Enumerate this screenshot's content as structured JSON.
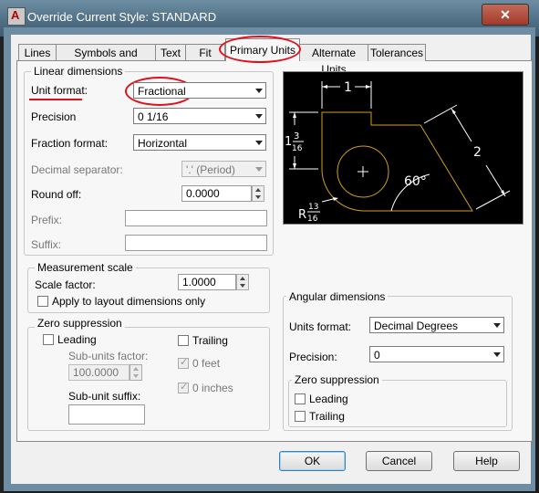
{
  "window": {
    "title": "Override Current Style: STANDARD",
    "close_glyph": "✕",
    "app_icon_letter": "A"
  },
  "tabs": [
    {
      "label": "Lines",
      "active": false
    },
    {
      "label": "Symbols and Arrows",
      "active": false
    },
    {
      "label": "Text",
      "active": false
    },
    {
      "label": "Fit",
      "active": false
    },
    {
      "label": "Primary Units",
      "active": true
    },
    {
      "label": "Alternate Units",
      "active": false
    },
    {
      "label": "Tolerances",
      "active": false
    }
  ],
  "linear": {
    "legend": "Linear dimensions",
    "unit_format": {
      "label": "Unit format:",
      "value": "Fractional"
    },
    "precision": {
      "label": "Precision",
      "value": "0 1/16"
    },
    "fraction_format": {
      "label": "Fraction format:",
      "value": "Horizontal"
    },
    "decimal_separator": {
      "label": "Decimal separator:",
      "value": "'.' (Period)"
    },
    "round_off": {
      "label": "Round off:",
      "value": "0.0000"
    },
    "prefix": {
      "label": "Prefix:",
      "value": ""
    },
    "suffix": {
      "label": "Suffix:",
      "value": ""
    }
  },
  "measurement": {
    "legend": "Measurement scale",
    "scale_factor": {
      "label": "Scale factor:",
      "value": "1.0000"
    },
    "apply_layout": {
      "label": "Apply to layout dimensions only",
      "checked": false
    }
  },
  "zero_suppression": {
    "legend": "Zero suppression",
    "leading": {
      "label": "Leading",
      "checked": false
    },
    "trailing": {
      "label": "Trailing",
      "checked": false
    },
    "sub_units_factor": {
      "label": "Sub-units factor:",
      "value": "100.0000"
    },
    "sub_unit_suffix": {
      "label": "Sub-unit suffix:",
      "value": ""
    },
    "zero_feet": {
      "label": "0 feet",
      "checked": true
    },
    "zero_inches": {
      "label": "0 inches",
      "checked": true
    }
  },
  "preview": {
    "dim_top": "1",
    "dim_left_whole": "1",
    "dim_left_num": "3",
    "dim_left_den": "16",
    "dim_right": "2",
    "dim_angle": "60°",
    "dim_radius_prefix": "R",
    "dim_radius_num": "13",
    "dim_radius_den": "16"
  },
  "angular": {
    "legend": "Angular dimensions",
    "units_format": {
      "label": "Units format:",
      "value": "Decimal Degrees"
    },
    "precision": {
      "label": "Precision:",
      "value": "0"
    },
    "zero_legend": "Zero suppression",
    "leading": {
      "label": "Leading",
      "checked": false
    },
    "trailing": {
      "label": "Trailing",
      "checked": false
    }
  },
  "buttons": {
    "ok": "OK",
    "cancel": "Cancel",
    "help": "Help"
  },
  "colors": {
    "annotation_red": "#e0101a",
    "preview_geometry": "#d4a017",
    "preview_dims": "#ffffff"
  }
}
